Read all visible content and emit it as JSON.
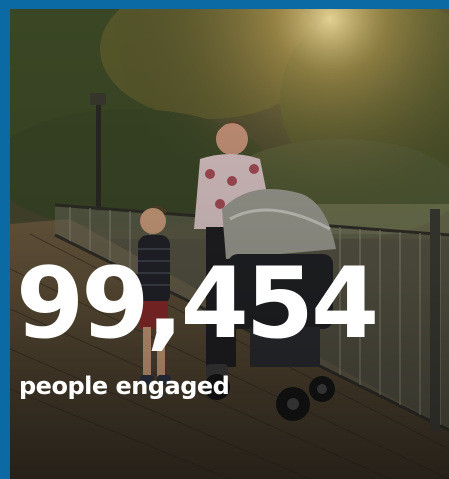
{
  "stat": {
    "value": "99,454",
    "label": "people engaged"
  },
  "colors": {
    "frame": "#0b6aa3",
    "text": "#ffffff"
  }
}
